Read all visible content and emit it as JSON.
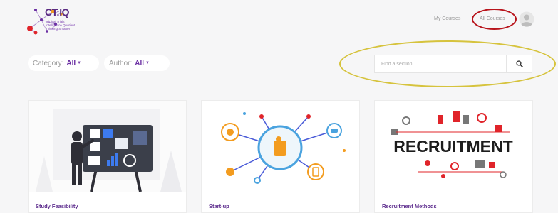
{
  "header": {
    "brand": "CT:IQ",
    "tagline_1": "Clinical Trials",
    "tagline_2": "Intelligence Quotient",
    "tagline_3": "Thinking Smarter",
    "nav": {
      "my_courses": "My Courses",
      "all_courses": "All Courses"
    }
  },
  "filters": {
    "category_label": "Category:",
    "category_value": "All",
    "author_label": "Author:",
    "author_value": "All"
  },
  "search": {
    "placeholder": "Find a section"
  },
  "courses": [
    {
      "title": "Study Feasibility"
    },
    {
      "title": "Start-up"
    },
    {
      "title": "Recruitment Methods",
      "image_text": "RECRUITMENT"
    }
  ],
  "colors": {
    "accent": "#5b2a8c",
    "annotation_red": "#b8141c",
    "annotation_yellow": "#d6c33d",
    "logo_red": "#e0242a",
    "logo_orange": "#f39c1f",
    "logo_purple": "#6b2fa3"
  }
}
